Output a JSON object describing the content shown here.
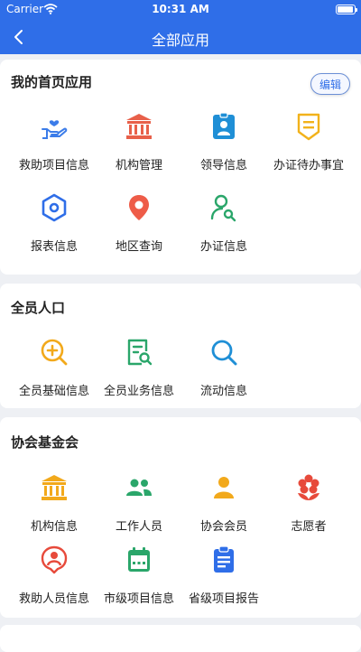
{
  "status_bar": {
    "carrier": "Carrier",
    "time": "10:31 AM"
  },
  "nav": {
    "title": "全部应用"
  },
  "sections": [
    {
      "title": "我的首页应用",
      "edit_label": "编辑",
      "items": [
        {
          "label": "救助项目信息",
          "icon": "helping-hand-heart-icon"
        },
        {
          "label": "机构管理",
          "icon": "institution-icon"
        },
        {
          "label": "领导信息",
          "icon": "id-badge-icon"
        },
        {
          "label": "办证待办事宜",
          "icon": "document-pending-icon"
        },
        {
          "label": "报表信息",
          "icon": "hexagon-icon"
        },
        {
          "label": "地区查询",
          "icon": "location-pin-icon"
        },
        {
          "label": "办证信息",
          "icon": "user-search-icon"
        }
      ]
    },
    {
      "title": "全员人口",
      "items": [
        {
          "label": "全员基础信息",
          "icon": "zoom-in-icon"
        },
        {
          "label": "全员业务信息",
          "icon": "document-search-icon"
        },
        {
          "label": "流动信息",
          "icon": "search-icon"
        }
      ]
    },
    {
      "title": "协会基金会",
      "items": [
        {
          "label": "机构信息",
          "icon": "institution-icon"
        },
        {
          "label": "工作人员",
          "icon": "staff-group-icon"
        },
        {
          "label": "协会会员",
          "icon": "member-icon"
        },
        {
          "label": "志愿者",
          "icon": "flower-icon"
        },
        {
          "label": "救助人员信息",
          "icon": "person-pin-icon"
        },
        {
          "label": "市级项目信息",
          "icon": "calendar-icon"
        },
        {
          "label": "省级项目报告",
          "icon": "clipboard-icon"
        }
      ]
    }
  ]
}
